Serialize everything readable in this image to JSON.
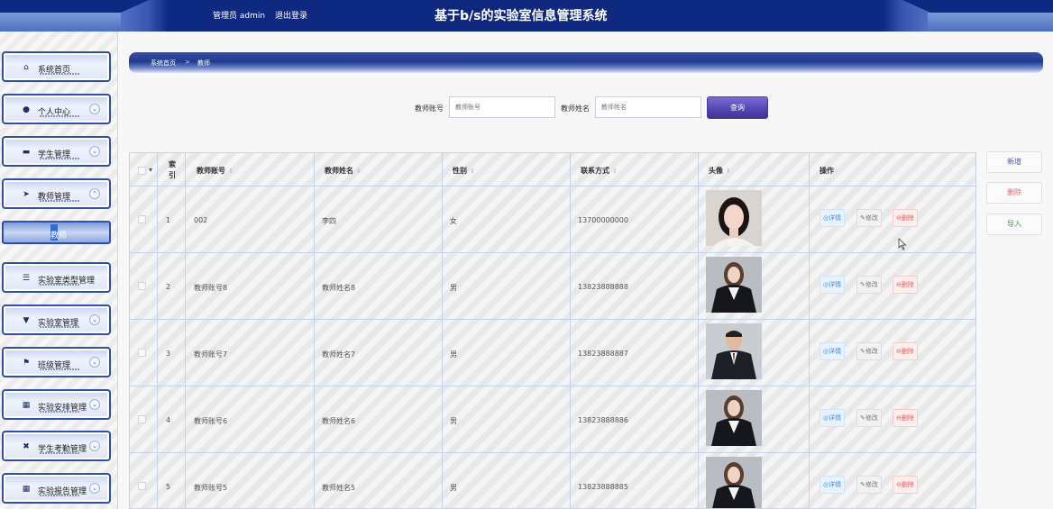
{
  "header": {
    "user_label": "管理员 admin",
    "logout_label": "退出登录",
    "title": "基于b/s的实验室信息管理系统"
  },
  "sidebar": {
    "items": [
      {
        "label": "系统首页",
        "icon": "home-icon",
        "has_chevron": false
      },
      {
        "label": "个人中心",
        "icon": "user-icon",
        "has_chevron": true
      },
      {
        "label": "学生管理",
        "icon": "student-icon",
        "has_chevron": true
      },
      {
        "label": "教师管理",
        "icon": "send-icon",
        "has_chevron": true,
        "expanded": true
      },
      {
        "label": "实验室类型管理",
        "icon": "sliders-icon",
        "has_chevron": false
      },
      {
        "label": "实验室管理",
        "icon": "lab-icon",
        "has_chevron": true
      },
      {
        "label": "班级管理",
        "icon": "flag-icon",
        "has_chevron": true
      },
      {
        "label": "实验安排管理",
        "icon": "grid-icon",
        "has_chevron": true
      },
      {
        "label": "学生考勤管理",
        "icon": "check-icon",
        "has_chevron": true
      },
      {
        "label": "实验报告管理",
        "icon": "grid-icon",
        "has_chevron": true
      }
    ],
    "submenu": {
      "label": "教师",
      "active": true
    }
  },
  "breadcrumb": {
    "home": "系统首页",
    "separator": ">",
    "current": "教师"
  },
  "search": {
    "account_label": "教师账号",
    "account_placeholder": "教师账号",
    "name_label": "教师姓名",
    "name_placeholder": "教师姓名",
    "button_label": "查询"
  },
  "table": {
    "columns": {
      "index": "索引",
      "account": "教师账号",
      "name": "教师姓名",
      "gender": "性别",
      "phone": "联系方式",
      "avatar": "头像",
      "actions": "操作"
    },
    "sort_symbol": "⇕",
    "rows": [
      {
        "index": "1",
        "account": "002",
        "name": "李四",
        "gender": "女",
        "phone": "13700000000",
        "avatar": "female-portrait"
      },
      {
        "index": "2",
        "account": "教师账号8",
        "name": "教师姓名8",
        "gender": "男",
        "phone": "13823888888",
        "avatar": "female-suit-portrait"
      },
      {
        "index": "3",
        "account": "教师账号7",
        "name": "教师姓名7",
        "gender": "男",
        "phone": "13823888887",
        "avatar": "male-suit-portrait"
      },
      {
        "index": "4",
        "account": "教师账号6",
        "name": "教师姓名6",
        "gender": "男",
        "phone": "13823888886",
        "avatar": "female-suit-portrait"
      },
      {
        "index": "5",
        "account": "教师账号5",
        "name": "教师姓名5",
        "gender": "男",
        "phone": "13823888885",
        "avatar": "female-suit-portrait"
      }
    ],
    "actions": {
      "detail": "详情",
      "edit": "修改",
      "delete": "删除"
    }
  },
  "side_buttons": {
    "add": "新增",
    "delete": "删除",
    "import": "导入"
  },
  "colors": {
    "header_bg": "#0f2980",
    "accent": "#2f4fa8",
    "search_button": "#5548b3",
    "detail": "#3b8ee8",
    "delete": "#e25b5b"
  }
}
